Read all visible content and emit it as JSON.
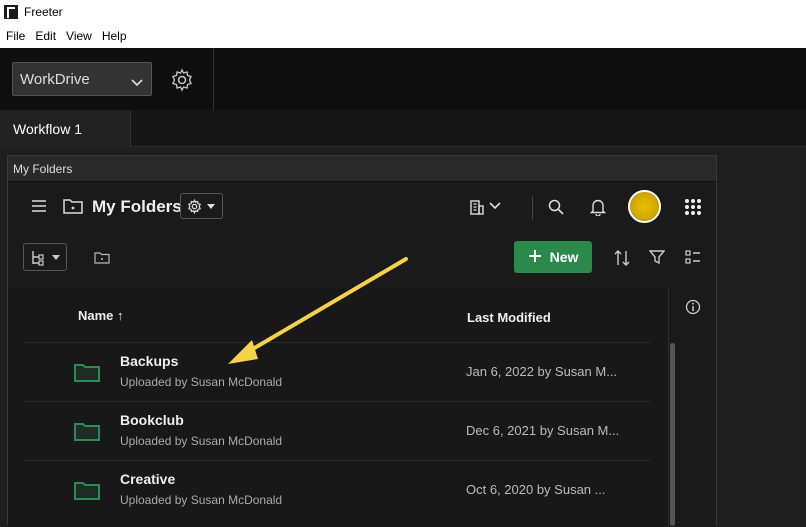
{
  "window": {
    "title": "Freeter"
  },
  "menu": [
    "File",
    "Edit",
    "View",
    "Help"
  ],
  "workspace": {
    "selected": "WorkDrive"
  },
  "tabs": [
    {
      "label": "Workflow 1"
    }
  ],
  "panel": {
    "header": "My Folders"
  },
  "app": {
    "title": "My Folders"
  },
  "toolbar": {
    "new_label": "New"
  },
  "table": {
    "columns": {
      "name": "Name ↑",
      "modified": "Last Modified"
    },
    "rows": [
      {
        "name": "Backups",
        "subtitle": "Uploaded by Susan McDonald",
        "modified": "Jan 6, 2022 by Susan M..."
      },
      {
        "name": "Bookclub",
        "subtitle": "Uploaded by Susan McDonald",
        "modified": "Dec 6, 2021 by Susan M..."
      },
      {
        "name": "Creative",
        "subtitle": "Uploaded by Susan McDonald",
        "modified": "Oct 6, 2020 by Susan ..."
      }
    ]
  },
  "colors": {
    "accent_green": "#2b8a4b",
    "folder_green": "#2e8b57",
    "arrow_yellow": "#f5d24a"
  },
  "icons": [
    "app-icon",
    "chevron-down-icon",
    "gear-icon",
    "hamburger-icon",
    "folder-icon",
    "building-icon",
    "search-icon",
    "bell-icon",
    "grid-icon",
    "tree-icon",
    "plus-icon",
    "sort-icon",
    "filter-icon",
    "list-settings-icon",
    "info-icon"
  ]
}
